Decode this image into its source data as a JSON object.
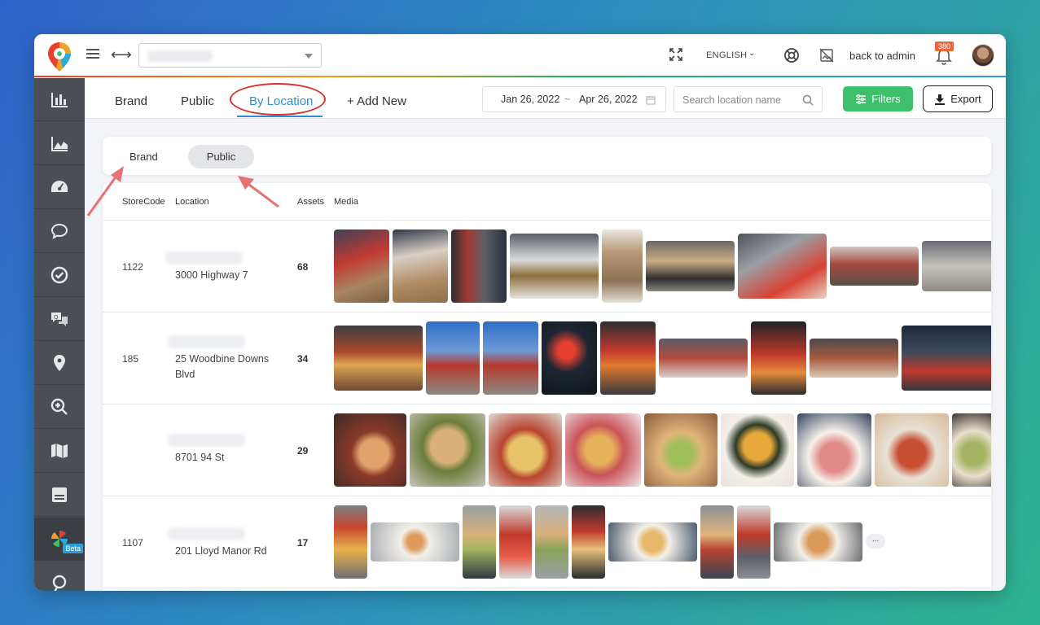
{
  "app": {
    "language": "ENGLISH",
    "back_to_admin": "back to admin",
    "notification_count": "380",
    "brand_select_value": ""
  },
  "sidebar": {
    "beta_label": "Beta"
  },
  "tabs": [
    {
      "label": "Brand"
    },
    {
      "label": "Public"
    },
    {
      "label": "By Location"
    },
    {
      "label": "+ Add New"
    }
  ],
  "daterange": {
    "start": "Jan 26, 2022",
    "separator": "~",
    "end": "Apr 26, 2022"
  },
  "search": {
    "placeholder": "Search location name"
  },
  "buttons": {
    "filters": "Filters",
    "export": "Export"
  },
  "toggle": {
    "brand": "Brand",
    "public": "Public"
  },
  "table": {
    "headers": {
      "storecode": "StoreCode",
      "location": "Location",
      "assets": "Assets",
      "media": "Media"
    },
    "rows": [
      {
        "storecode": "1122",
        "location": "3000 Highway 7",
        "assets": "68"
      },
      {
        "storecode": "185",
        "location": "25 Woodbine Downs Blvd",
        "assets": "34"
      },
      {
        "storecode": "",
        "location": "8701 94 St",
        "assets": "29"
      },
      {
        "storecode": "1107",
        "location": "201 Lloyd Manor Rd",
        "assets": "17",
        "more": "..."
      }
    ]
  },
  "colors": {
    "accent_blue": "#2a8dd4",
    "filters_green": "#3dbf6b",
    "sidebar": "#4b4f55",
    "annotation_red": "#d9322b"
  }
}
